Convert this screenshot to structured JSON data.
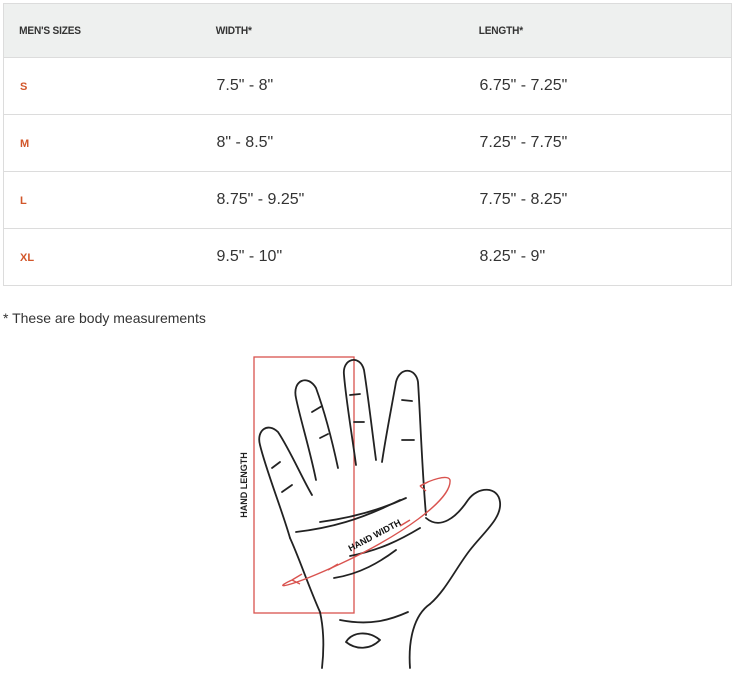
{
  "table": {
    "headers": [
      "MEN'S SIZES",
      "WIDTH*",
      "LENGTH*"
    ],
    "rows": [
      {
        "size": "S",
        "width": "7.5\" - 8\"",
        "length": "6.75\" - 7.25\""
      },
      {
        "size": "M",
        "width": "8\" - 8.5\"",
        "length": "7.25\" - 7.75\""
      },
      {
        "size": "L",
        "width": "8.75\" - 9.25\"",
        "length": "7.75\" - 8.25\""
      },
      {
        "size": "XL",
        "width": "9.5\" - 10\"",
        "length": "8.25\" - 9\""
      }
    ]
  },
  "note": "* These are body measurements",
  "diagram": {
    "hand_length_label": "HAND LENGTH",
    "hand_width_label": "HAND WIDTH"
  },
  "colors": {
    "accent": "#d2562a",
    "measure_lines": "#d9534f",
    "header_bg": "#eef0ef",
    "border": "#dcdcdc"
  }
}
